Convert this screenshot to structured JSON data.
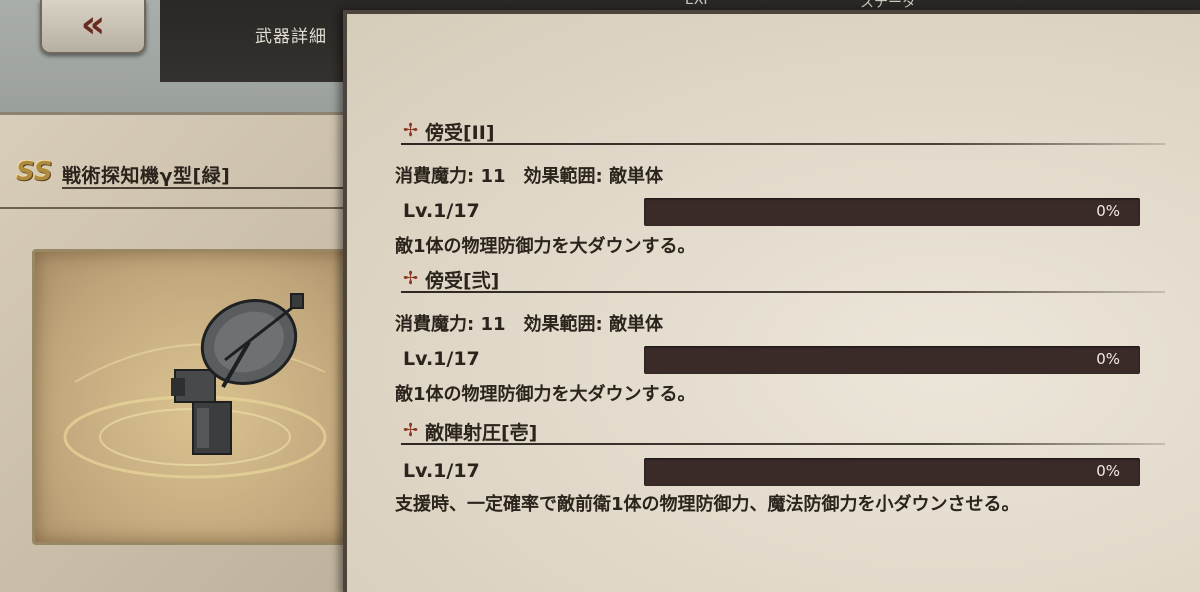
{
  "header": {
    "title": "武器詳細",
    "exp_label": "EXP",
    "stat_label": "ステータ"
  },
  "back_button": {
    "icon": "double-chevron-left-icon",
    "glyph": "«"
  },
  "item": {
    "rank": "SS",
    "name": "戦術探知機γ型[緑]"
  },
  "skills": [
    {
      "name": "傍受[II]",
      "cost_line": "消費魔力: 11　効果範囲: 敵単体",
      "level": "Lv.1/17",
      "progress": 0,
      "progress_label": "0%",
      "description": "敵1体の物理防御力を大ダウンする。"
    },
    {
      "name": "傍受[弐]",
      "cost_line": "消費魔力: 11　効果範囲: 敵単体",
      "level": "Lv.1/17",
      "progress": 0,
      "progress_label": "0%",
      "description": "敵1体の物理防御力を大ダウンする。"
    },
    {
      "name": "敵陣射圧[壱]",
      "cost_line": "",
      "level": "Lv.1/17",
      "progress": 0,
      "progress_label": "0%",
      "description": "支援時、一定確率で敵前衛1体の物理防御力、魔法防御力を小ダウンさせる。"
    }
  ],
  "colors": {
    "panel_bg": "#e2dacb",
    "text": "#2b241c",
    "progress_track": "#3a2b28",
    "skill_icon": "#8a3a24",
    "rank_gold": "#b08a3e"
  }
}
